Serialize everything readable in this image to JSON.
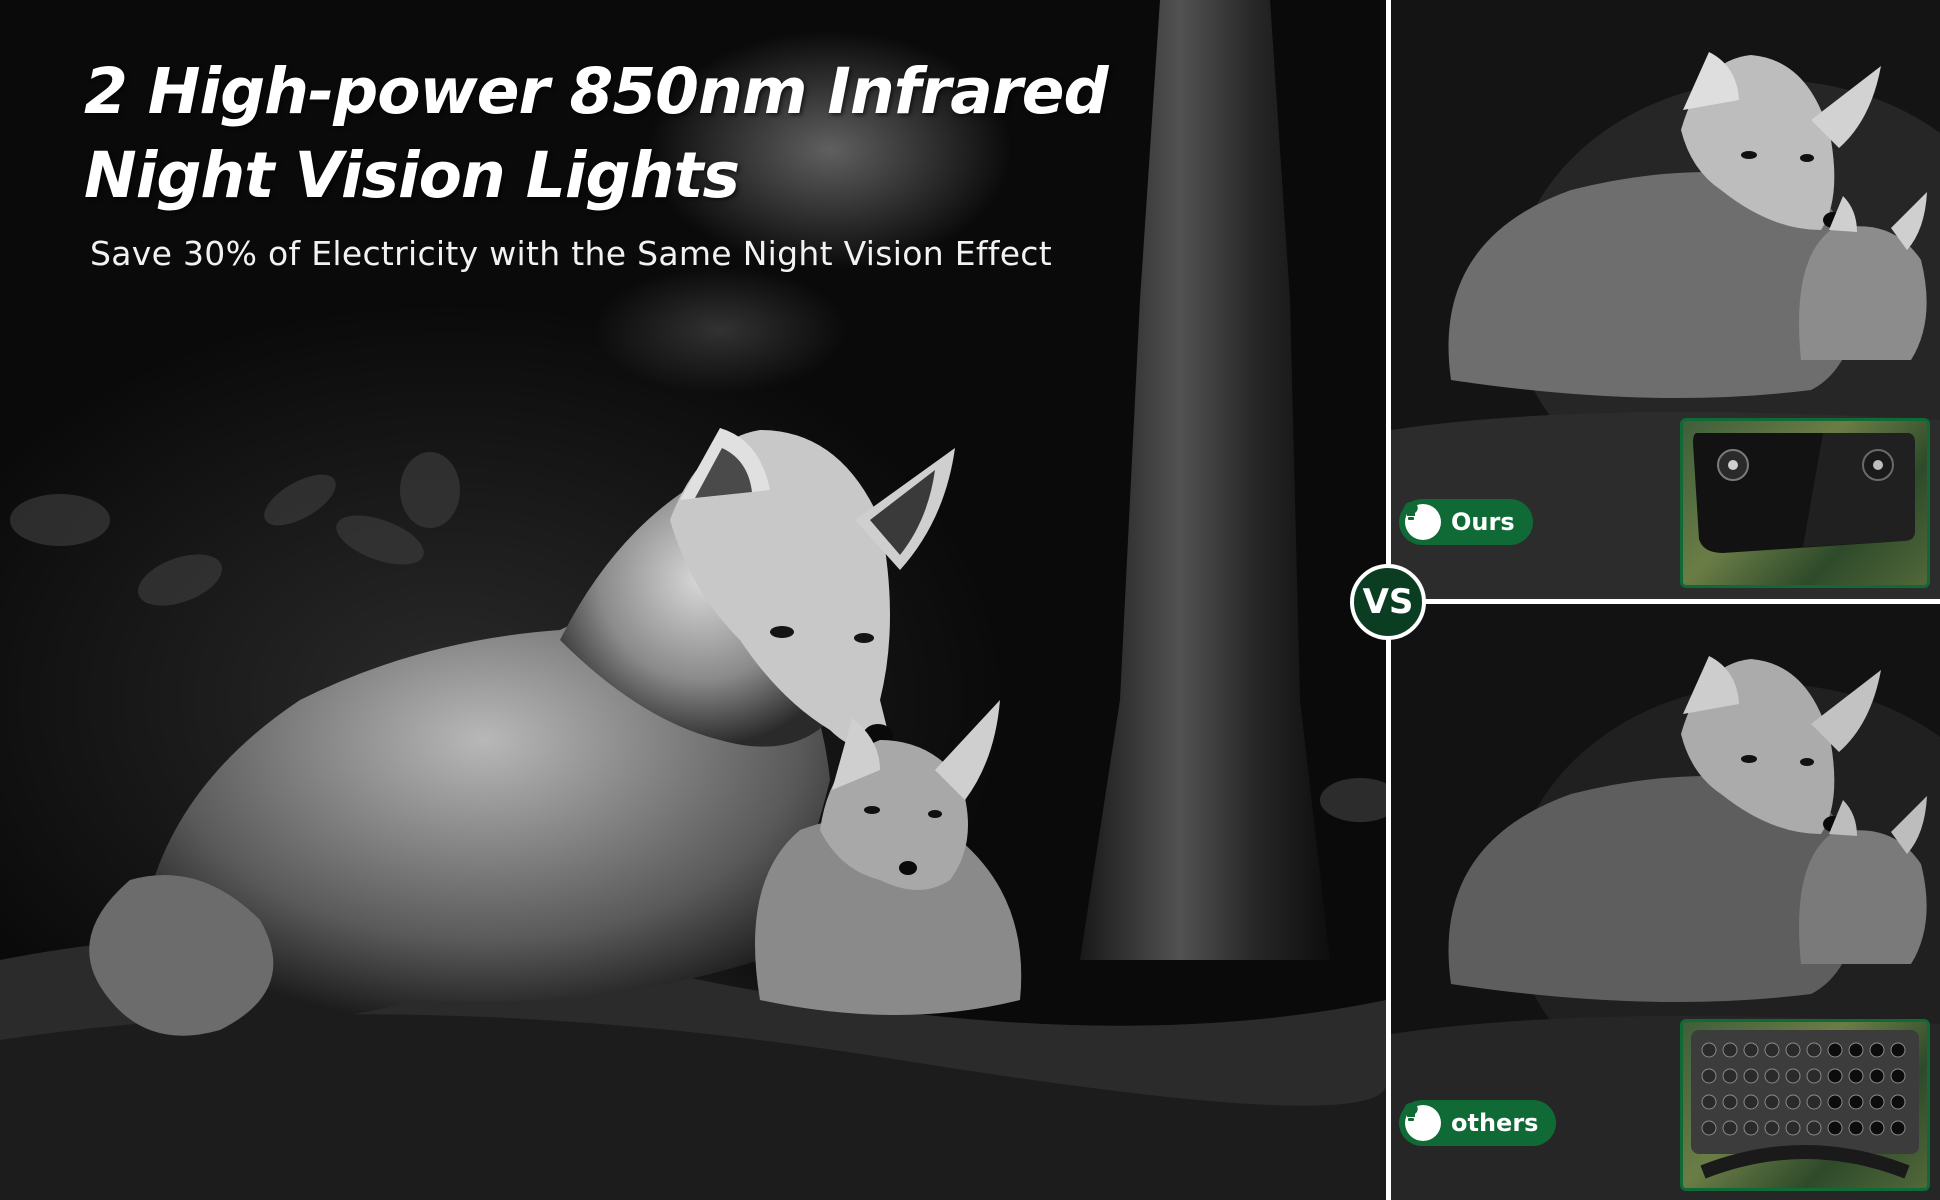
{
  "headline": {
    "line1": "2 High-power 850nm Infrared",
    "line2": "Night Vision Lights"
  },
  "subheadline": "Save 30% of Electricity with the Same Night Vision Effect",
  "comparison": {
    "vs_label": "VS",
    "top": {
      "label": "Ours",
      "icon": "lightbulb-icon",
      "led_count": 2
    },
    "bottom": {
      "label": "others",
      "icon": "lightbulb-icon",
      "led_count": 40
    }
  },
  "colors": {
    "accent_green": "#0f6a36",
    "dark_green": "#0b3d22",
    "text": "#ffffff"
  }
}
